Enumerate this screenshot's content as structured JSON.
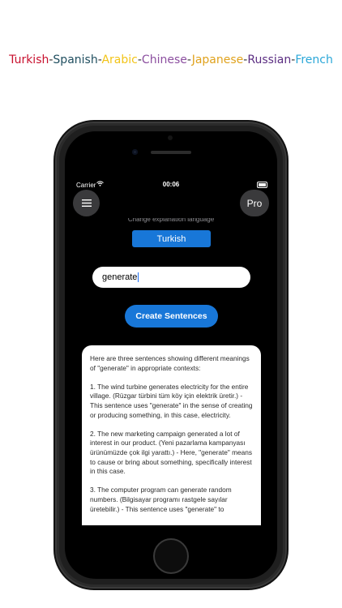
{
  "languages_banner": {
    "items": [
      {
        "label": "Turkish",
        "color": "#c8102e"
      },
      {
        "label": "Spanish",
        "color": "#1f4e5f"
      },
      {
        "label": "Arabic",
        "color": "#f2c418"
      },
      {
        "label": "Chinese",
        "color": "#8c4fa0"
      },
      {
        "label": "Japanese",
        "color": "#e0a21c"
      },
      {
        "label": "Russian",
        "color": "#5b2d82"
      },
      {
        "label": "French",
        "color": "#2aa7d8"
      }
    ],
    "separator": "-"
  },
  "status_bar": {
    "carrier": "Carrier",
    "time": "00:06"
  },
  "header": {
    "menu_icon": "hamburger-menu-icon",
    "pro_label": "Pro"
  },
  "language_section": {
    "label": "Change explanation language",
    "selected_language": "Turkish"
  },
  "word_input": {
    "value": "generate"
  },
  "create_button": {
    "label": "Create Sentences"
  },
  "result": {
    "paragraphs": [
      "Here are three sentences showing different meanings of \"generate\" in appropriate contexts:",
      "1. The wind turbine generates electricity for the entire village.  (Rüzgar türbini tüm köy için elektrik üretir.) - This sentence uses \"generate\" in the sense of creating or producing something, in this case, electricity.",
      "2. The new marketing campaign generated a lot of interest in our product. (Yeni pazarlama kampanyası ürünümüzde çok ilgi yarattı.) - Here, \"generate\" means to cause or bring about something, specifically interest in this case.",
      "3. The computer program can generate random numbers. (Bilgisayar programı rastgele sayılar üretebilir.) - This sentence uses \"generate\" to"
    ]
  }
}
